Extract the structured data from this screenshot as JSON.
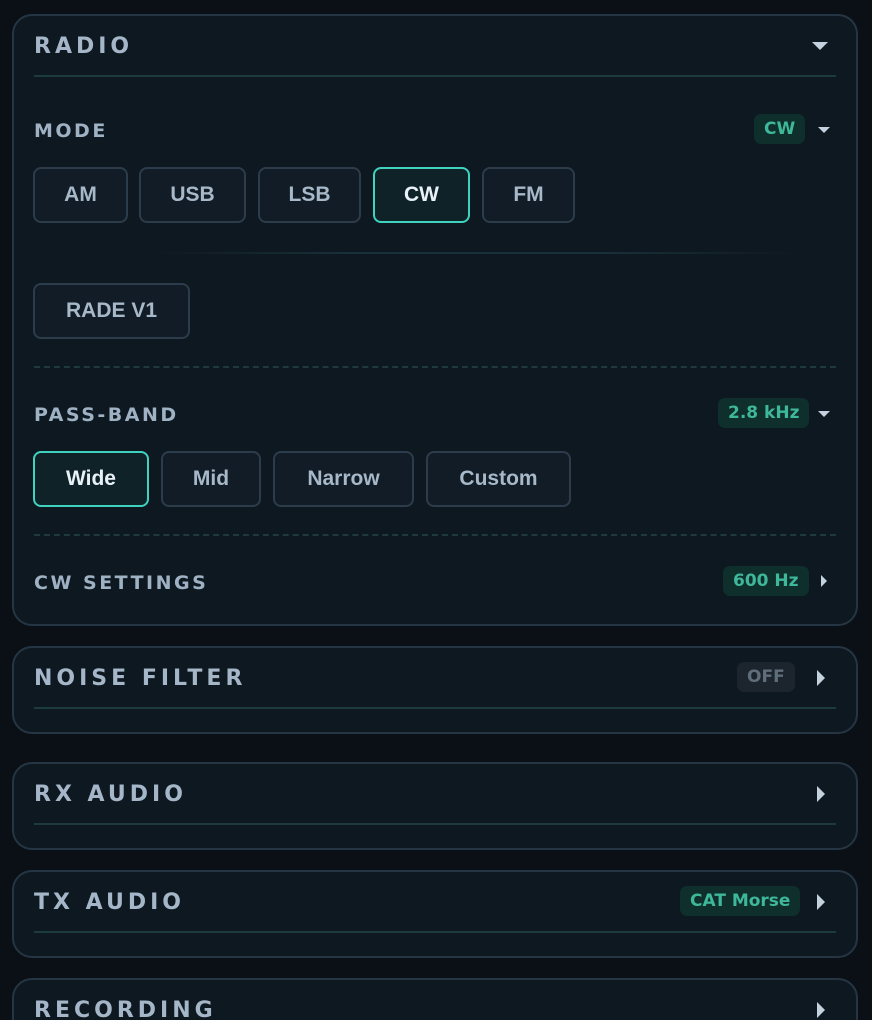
{
  "radio": {
    "title": "RADIO",
    "mode": {
      "label": "MODE",
      "badge": "CW",
      "buttons": [
        "AM",
        "USB",
        "LSB",
        "CW",
        "FM"
      ],
      "selected": "CW",
      "extra_button": "RADE V1"
    },
    "passband": {
      "label": "PASS-BAND",
      "badge": "2.8 kHz",
      "buttons": [
        "Wide",
        "Mid",
        "Narrow",
        "Custom"
      ],
      "selected": "Wide"
    },
    "cw_settings": {
      "label": "CW SETTINGS",
      "badge": "600 Hz"
    }
  },
  "noise_filter": {
    "title": "NOISE FILTER",
    "badge": "OFF"
  },
  "rx_audio": {
    "title": "RX AUDIO"
  },
  "tx_audio": {
    "title": "TX AUDIO",
    "badge": "CAT Morse"
  },
  "recording": {
    "title": "RECORDING"
  },
  "colors": {
    "accent": "#3fd2bf",
    "badge_text": "#3fb79a",
    "badge_bg": "#0e2f2b",
    "panel_bg": "#0e1821",
    "panel_border": "#253543"
  },
  "icons": {
    "collapse": "chevron-down-icon",
    "expand": "chevron-right-icon"
  }
}
